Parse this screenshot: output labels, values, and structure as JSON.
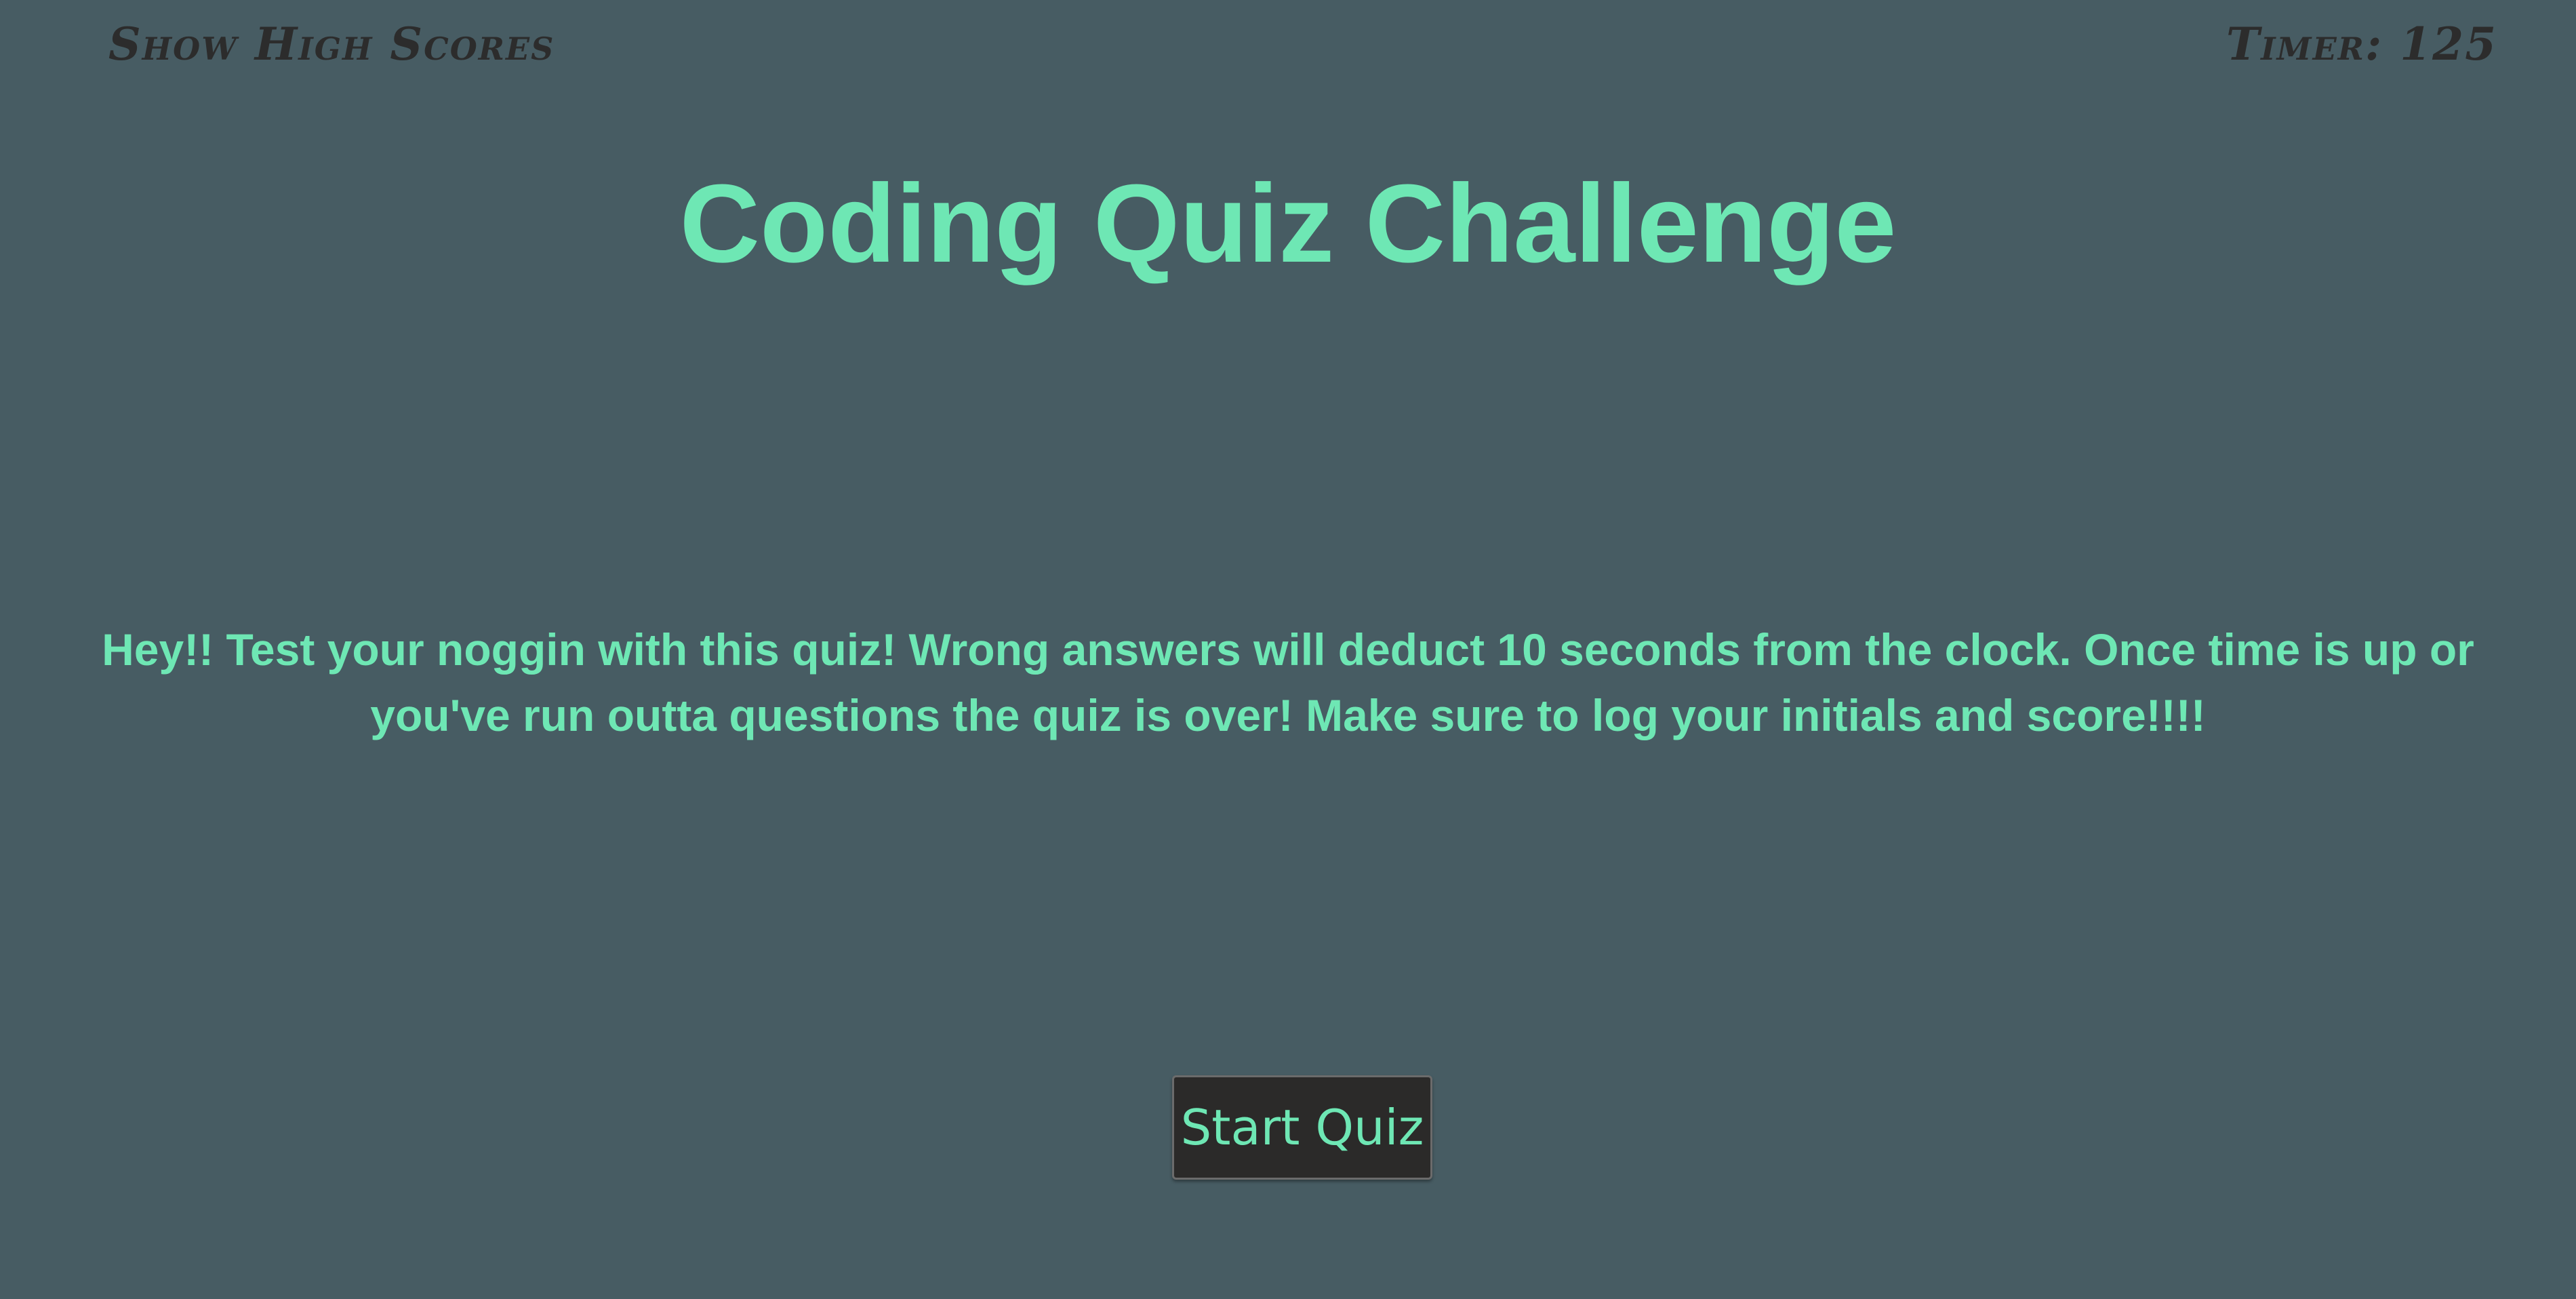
{
  "header": {
    "high_scores_label": "Show High Scores",
    "timer_label": "Timer: 125"
  },
  "main": {
    "title": "Coding Quiz Challenge",
    "intro_text": "Hey!! Test your noggin with this quiz! Wrong answers will deduct 10 seconds from the clock. Once time is up or you've run outta questions the quiz is over! Make sure to log your initials and score!!!!",
    "start_button_label": "Start Quiz"
  },
  "colors": {
    "background": "#475c63",
    "accent": "#6ee7b4",
    "header_text": "#2c2c2c",
    "button_bg": "#2b2a29"
  }
}
